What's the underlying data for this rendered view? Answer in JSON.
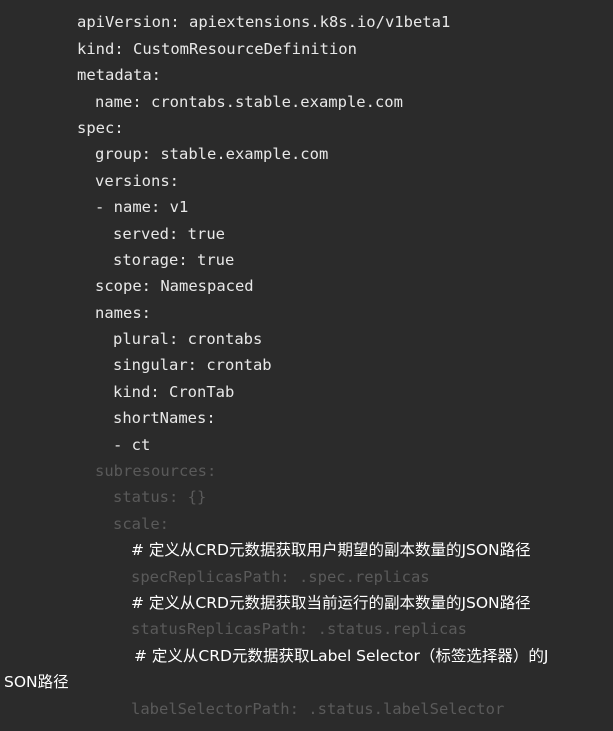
{
  "code": {
    "l1": "apiVersion: apiextensions.k8s.io/v1beta1",
    "l2": "kind: CustomResourceDefinition",
    "l3": "metadata:",
    "l4": "name: crontabs.stable.example.com",
    "l5": "spec:",
    "l6": "group: stable.example.com",
    "l7": "versions:",
    "l8": "- name: v1",
    "l9": "served: true",
    "l10": "storage: true",
    "l11": "scope: Namespaced",
    "l12": "names:",
    "l13": "plural: crontabs",
    "l14": "singular: crontab",
    "l15": "kind: CronTab",
    "l16": "shortNames:",
    "l17": "- ct",
    "l18": "subresources:",
    "l19": "status: {}",
    "l20": "scale:",
    "l21": "# 定义从CRD元数据获取用户期望的副本数量的JSON路径",
    "l22": "specReplicasPath: .spec.replicas",
    "l23": "# 定义从CRD元数据获取当前运行的副本数量的JSON路径",
    "l24": "statusReplicasPath: .status.replicas",
    "l25a": "# 定义从CRD元数据获取Label Selector（标签选择器）的J",
    "l25b": "SON路径",
    "l26": "labelSelectorPath: .status.labelSelector"
  },
  "colors": {
    "background": "#2b2b2b",
    "text": "#e8e8e8",
    "dimmed": "#5a5a5a"
  }
}
